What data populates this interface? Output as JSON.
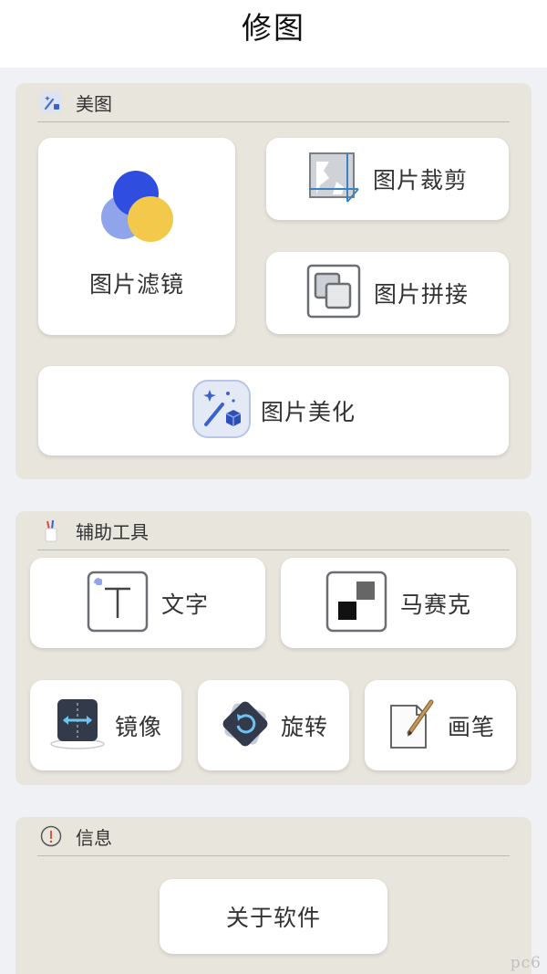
{
  "header": {
    "title": "修图"
  },
  "beautify": {
    "section_title": "美图",
    "filter_label": "图片滤镜",
    "crop_label": "图片裁剪",
    "splice_label": "图片拼接",
    "enhance_label": "图片美化"
  },
  "tools": {
    "section_title": "辅助工具",
    "text_label": "文字",
    "mosaic_label": "马赛克",
    "mirror_label": "镜像",
    "rotate_label": "旋转",
    "brush_label": "画笔"
  },
  "info": {
    "section_title": "信息",
    "about_label": "关于软件"
  },
  "watermark": "pc6",
  "colors": {
    "panel_bg": "#e8e5dd",
    "page_bg": "#f0f1f4",
    "accent_blue": "#2f4ee0",
    "accent_yellow": "#f3c94b",
    "accent_light_blue": "#8fa4ea"
  }
}
